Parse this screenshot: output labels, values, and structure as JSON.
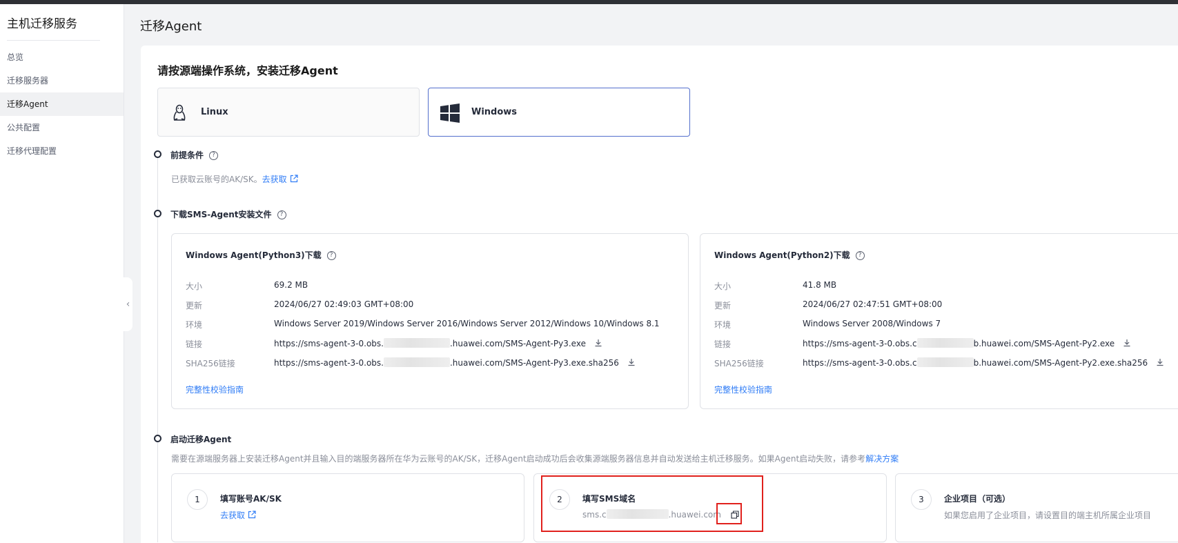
{
  "sidebar": {
    "title": "主机迁移服务",
    "items": [
      {
        "label": "总览"
      },
      {
        "label": "迁移服务器"
      },
      {
        "label": "迁移Agent"
      },
      {
        "label": "公共配置"
      },
      {
        "label": "迁移代理配置"
      }
    ]
  },
  "page": {
    "title": "迁移Agent",
    "section_title": "请按源端操作系统，安装迁移Agent",
    "os_tabs": [
      {
        "label": "Linux"
      },
      {
        "label": "Windows"
      }
    ]
  },
  "steps": {
    "prereq": {
      "title": "前提条件",
      "desc": "已获取云账号的AK/SK。",
      "link": "去获取"
    },
    "download": {
      "title": "下载SMS-Agent安装文件",
      "cards": [
        {
          "title": "Windows Agent(Python3)下载",
          "size_label": "大小",
          "size": "69.2 MB",
          "updated_label": "更新",
          "updated": "2024/06/27 02:49:03 GMT+08:00",
          "env_label": "环境",
          "env": "Windows Server 2019/Windows Server 2016/Windows Server 2012/Windows 10/Windows 8.1",
          "link_label": "链接",
          "link_prefix": "https://sms-agent-3-0.obs.",
          "link_suffix": ".huawei.com/SMS-Agent-Py3.exe",
          "sha_label": "SHA256链接",
          "sha_prefix": "https://sms-agent-3-0.obs.",
          "sha_suffix": ".huawei.com/SMS-Agent-Py3.exe.sha256",
          "guide": "完整性校验指南"
        },
        {
          "title": "Windows Agent(Python2)下载",
          "size_label": "大小",
          "size": "41.8 MB",
          "updated_label": "更新",
          "updated": "2024/06/27 02:47:51 GMT+08:00",
          "env_label": "环境",
          "env": "Windows Server 2008/Windows 7",
          "link_label": "链接",
          "link_prefix": "https://sms-agent-3-0.obs.c",
          "link_suffix": "b.huawei.com/SMS-Agent-Py2.exe",
          "sha_label": "SHA256链接",
          "sha_prefix": "https://sms-agent-3-0.obs.c",
          "sha_suffix": "b.huawei.com/SMS-Agent-Py2.exe.sha256",
          "guide": "完整性校验指南"
        }
      ]
    },
    "start": {
      "title": "启动迁移Agent",
      "desc": "需要在源端服务器上安装迁移Agent并且输入目的端服务器所在华为云账号的AK/SK，迁移Agent启动成功后会收集源端服务器信息并自动发送给主机迁移服务。如果Agent启动失败，请参考",
      "link": "解决方案",
      "cards": [
        {
          "num": "1",
          "title": "填写账号AK/SK",
          "link": "去获取"
        },
        {
          "num": "2",
          "title": "填写SMS域名",
          "prefix": "sms.c",
          "suffix": ".huawei.com"
        },
        {
          "num": "3",
          "title": "企业项目（可选）",
          "text": "如果您启用了企业项目，请设置目的端主机所属企业项目"
        }
      ]
    }
  },
  "colors": {
    "accent": "#2f7cf6",
    "selected_border": "#526ecc",
    "highlight": "#e0201c"
  }
}
